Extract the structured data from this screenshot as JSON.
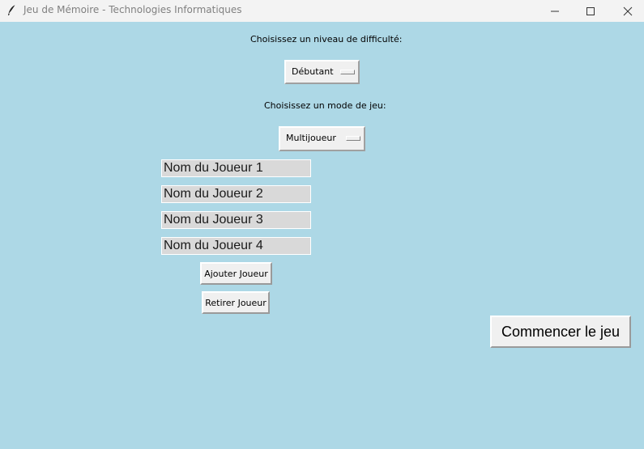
{
  "window": {
    "title": "Jeu de Mémoire - Technologies Informatiques",
    "background": "#add8e6",
    "icon": "feather-icon"
  },
  "difficulty": {
    "label": "Choisissez un niveau de difficulté:",
    "selected": "Débutant"
  },
  "mode": {
    "label": "Choisissez un mode de jeu:",
    "selected": "Multijoueur"
  },
  "players": [
    {
      "value": "Nom du Joueur 1"
    },
    {
      "value": "Nom du Joueur 2"
    },
    {
      "value": "Nom du Joueur 3"
    },
    {
      "value": "Nom du Joueur 4"
    }
  ],
  "buttons": {
    "add_player": "Ajouter Joueur",
    "remove_player": "Retirer Joueur",
    "start": "Commencer le jeu"
  }
}
